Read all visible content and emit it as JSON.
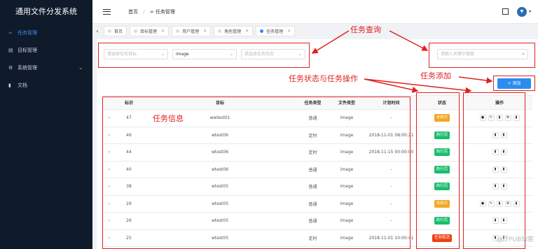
{
  "app": {
    "title": "通用文件分发系统"
  },
  "sidebar": {
    "items": [
      {
        "label": "任务管理",
        "icon": "infinity-icon",
        "active": true
      },
      {
        "label": "目标管理",
        "icon": "database-icon"
      },
      {
        "label": "系统管理",
        "icon": "gear-icon",
        "expandable": true
      },
      {
        "label": "文档",
        "icon": "book-icon"
      }
    ]
  },
  "header": {
    "breadcrumb_home": "首页",
    "breadcrumb_sep": "/",
    "breadcrumb_icon": "∞",
    "breadcrumb_current": "任务管理",
    "avatar_text": "▼"
  },
  "tabs": [
    {
      "label": "首页"
    },
    {
      "label": "目标管理"
    },
    {
      "label": "用户管理"
    },
    {
      "label": "角色管理"
    },
    {
      "label": "任务管理",
      "active": true
    }
  ],
  "filters": {
    "target_placeholder": "请选择任务目标",
    "file_type_value": "image",
    "status_placeholder": "请选择任务状态",
    "search_placeholder": "请输入关键字搜索"
  },
  "add_button": {
    "label": "+ 添加"
  },
  "table": {
    "headers": [
      "标识",
      "目标",
      "任务类型",
      "文件类型",
      "计划时间",
      "状态",
      "操作"
    ],
    "rows": [
      {
        "id": "47",
        "target": "wwtest01",
        "type": "普通",
        "file_type": "image",
        "time": "-",
        "status": "未执行",
        "status_color": "orange",
        "ops": 5
      },
      {
        "id": "46",
        "target": "wtest06",
        "type": "定时",
        "file_type": "image",
        "time": "2018-11-01 08:00:21",
        "status": "执行完",
        "status_color": "green",
        "ops": 2
      },
      {
        "id": "44",
        "target": "wtest06",
        "type": "定时",
        "file_type": "image",
        "time": "2018-11-15 00:00:00",
        "status": "执行完",
        "status_color": "green",
        "ops": 2
      },
      {
        "id": "40",
        "target": "wtest06",
        "type": "普通",
        "file_type": "image",
        "time": "-",
        "status": "执行完",
        "status_color": "green",
        "ops": 2
      },
      {
        "id": "38",
        "target": "wtest05",
        "type": "普通",
        "file_type": "image",
        "time": "-",
        "status": "执行完",
        "status_color": "green",
        "ops": 2
      },
      {
        "id": "29",
        "target": "wtest05",
        "type": "普通",
        "file_type": "image",
        "time": "-",
        "status": "未执行",
        "status_color": "orange",
        "ops": 5
      },
      {
        "id": "26",
        "target": "wtest05",
        "type": "普通",
        "file_type": "image",
        "time": "-",
        "status": "执行完",
        "status_color": "green",
        "ops": 2
      },
      {
        "id": "25",
        "target": "wtest05",
        "type": "定时",
        "file_type": "image",
        "time": "2018-11-01 10:00:41",
        "status": "任务取消",
        "status_color": "red",
        "ops": 2
      }
    ]
  },
  "annotations": {
    "query": "任务查询",
    "add": "任务添加",
    "status_ops": "任务状态与任务操作",
    "info": "任务信息"
  },
  "watermark": "@ITPUB博客",
  "colors": {
    "accent": "#2d8cf0",
    "annotation": "#e02020",
    "sidebar_bg": "#0f1a2b"
  }
}
